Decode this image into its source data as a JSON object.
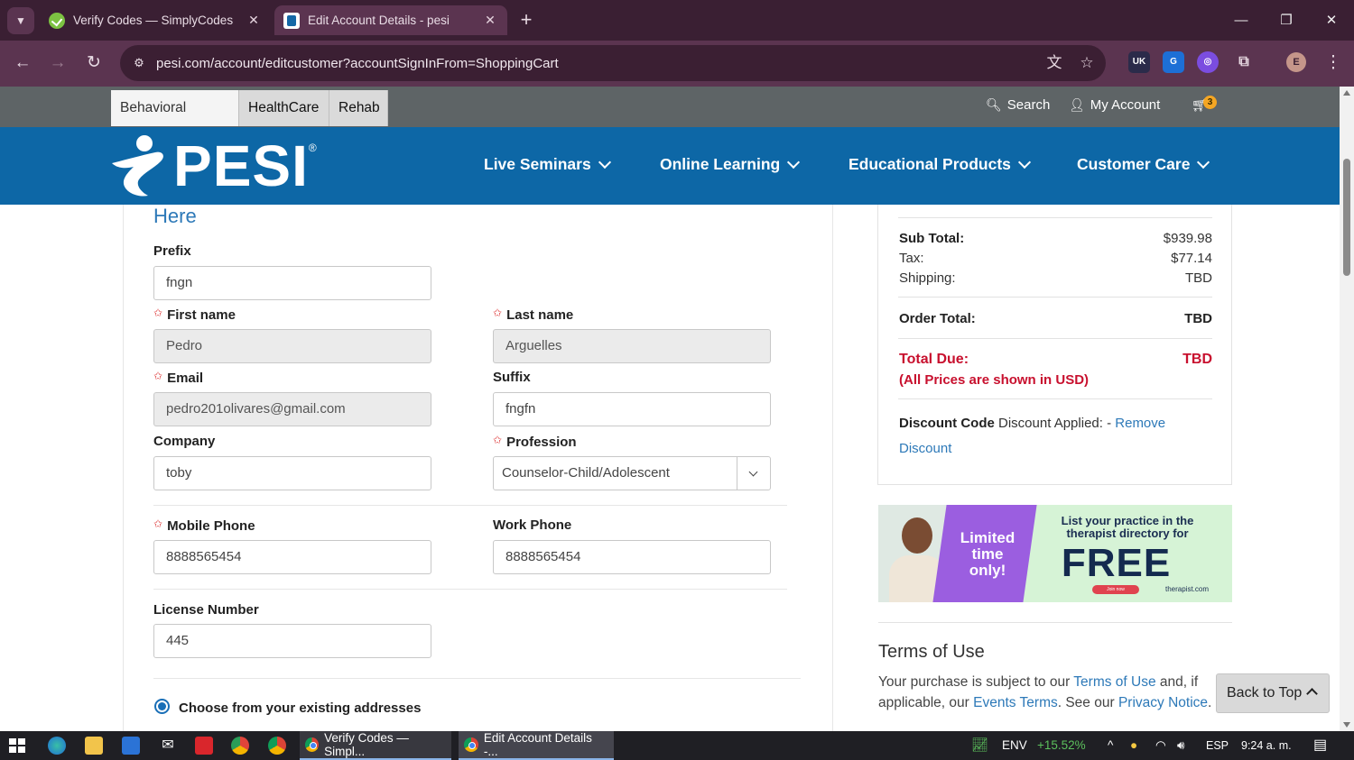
{
  "browser": {
    "tabs": [
      {
        "title": "Verify Codes — SimplyCodes",
        "active": false
      },
      {
        "title": "Edit Account Details - pesi",
        "active": true
      }
    ],
    "url": "pesi.com/account/editcustomer?accountSignInFrom=ShoppingCart",
    "profile_initial": "E",
    "ext_uk_label": "UK"
  },
  "site_top": {
    "categories": [
      "Behavioral Health",
      "HealthCare",
      "Rehab"
    ],
    "search_label": "Search",
    "account_label": "My Account",
    "cart_count": "3"
  },
  "header": {
    "logo_text": "PESI",
    "logo_reg": "®",
    "nav": [
      "Live Seminars",
      "Online Learning",
      "Educational Products",
      "Customer Care"
    ]
  },
  "form": {
    "heading_fragment": "Here",
    "required_mark": "✩",
    "prefix": {
      "label": "Prefix",
      "value": "fngn"
    },
    "first_name": {
      "label": "First name",
      "value": "Pedro"
    },
    "last_name": {
      "label": "Last name",
      "value": "Arguelles"
    },
    "email": {
      "label": "Email",
      "value": "pedro201olivares@gmail.com"
    },
    "suffix": {
      "label": "Suffix",
      "value": "fngfn"
    },
    "company": {
      "label": "Company",
      "value": "toby"
    },
    "profession": {
      "label": "Profession",
      "value": "Counselor-Child/Adolescent"
    },
    "mobile_phone": {
      "label": "Mobile Phone",
      "value": "8888565454"
    },
    "work_phone": {
      "label": "Work Phone",
      "value": "8888565454"
    },
    "license_number": {
      "label": "License Number",
      "value": "445"
    },
    "address_option": "Choose from your existing addresses"
  },
  "summary": {
    "subtotal_label": "Sub Total:",
    "subtotal": "$939.98",
    "tax_label": "Tax:",
    "tax": "$77.14",
    "shipping_label": "Shipping:",
    "shipping": "TBD",
    "order_total_label": "Order Total:",
    "order_total": "TBD",
    "total_due_label": "Total Due:",
    "total_due": "TBD",
    "usd_note": "(All Prices are shown in USD)",
    "discount_label": "Discount Code",
    "discount_text": "Discount Applied: - ",
    "remove_discount": "Remove Discount"
  },
  "ad": {
    "limited": "Limited time only!",
    "headline": "List your practice in the therapist directory for",
    "free": "FREE",
    "button": "Join now",
    "brand": "therapist.com"
  },
  "terms": {
    "title": "Terms of Use",
    "text_1": "Your purchase is subject to our ",
    "terms_link": "Terms of Use",
    "text_2": " and, if applicable, our ",
    "events_link": "Events Terms",
    "text_3": ". See our ",
    "privacy_link": "Privacy Notice",
    "text_4": "."
  },
  "back_to_top": "Back to Top",
  "taskbar": {
    "apps": [
      "Verify Codes — Simpl...",
      "Edit Account Details -..."
    ],
    "env_label": "ENV",
    "env_change": "+15.52%",
    "lang": "ESP",
    "time": "9:24 a. m."
  }
}
